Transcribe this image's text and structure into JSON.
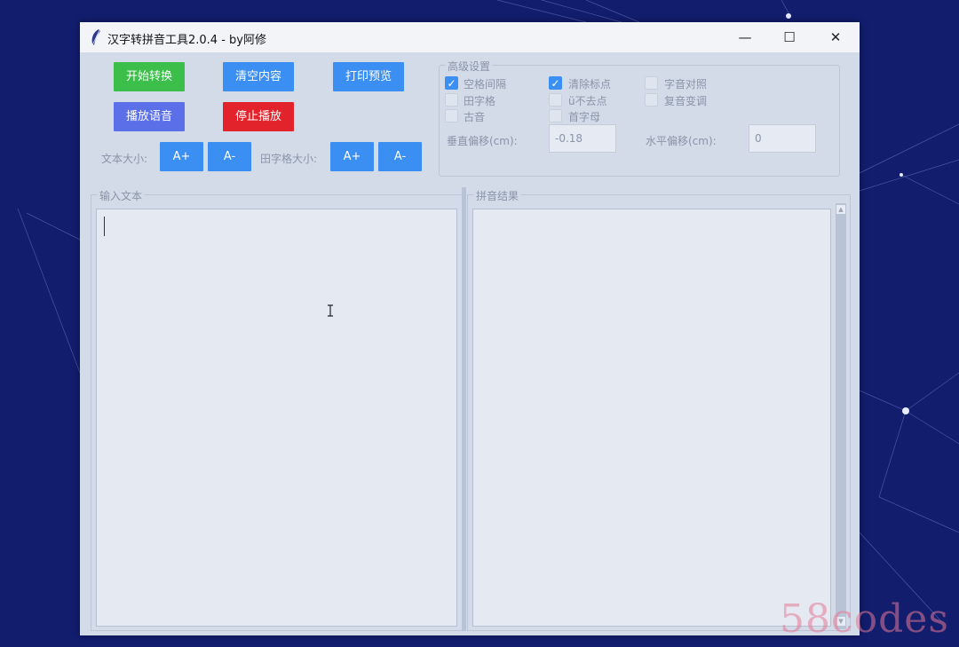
{
  "window": {
    "title": "汉字转拼音工具2.0.4 - by阿修",
    "controls": {
      "minimize": "—",
      "maximize": "☐",
      "close": "✕"
    }
  },
  "buttons": {
    "start": "开始转换",
    "clear": "清空内容",
    "print_preview": "打印预览",
    "play_voice": "播放语音",
    "stop_play": "停止播放"
  },
  "font_size": {
    "text_label": "文本大小:",
    "grid_label": "田字格大小:",
    "increase": "A+",
    "decrease": "A-"
  },
  "advanced": {
    "title": "高级设置",
    "options": [
      {
        "label": "空格间隔",
        "checked": true
      },
      {
        "label": "清除标点",
        "checked": true
      },
      {
        "label": "字音对照",
        "checked": false
      },
      {
        "label": "田字格",
        "checked": false
      },
      {
        "label": "ü不去点",
        "checked": false
      },
      {
        "label": "复音变调",
        "checked": false
      },
      {
        "label": "古音",
        "checked": false
      },
      {
        "label": "首字母",
        "checked": false
      }
    ],
    "vertical_offset_label": "垂直偏移(cm):",
    "vertical_offset_value": "-0.18",
    "horizontal_offset_label": "水平偏移(cm):",
    "horizontal_offset_value": "0"
  },
  "input_panel": {
    "title": "输入文本",
    "value": ""
  },
  "result_panel": {
    "title": "拼音结果",
    "value": ""
  },
  "watermark": "58codes",
  "colors": {
    "background": "#121d6e",
    "window": "#d3dbe9",
    "accent_blue": "#3b8ff2",
    "green": "#3cbf4a",
    "purple": "#5a6fe8",
    "red": "#e3232b"
  }
}
